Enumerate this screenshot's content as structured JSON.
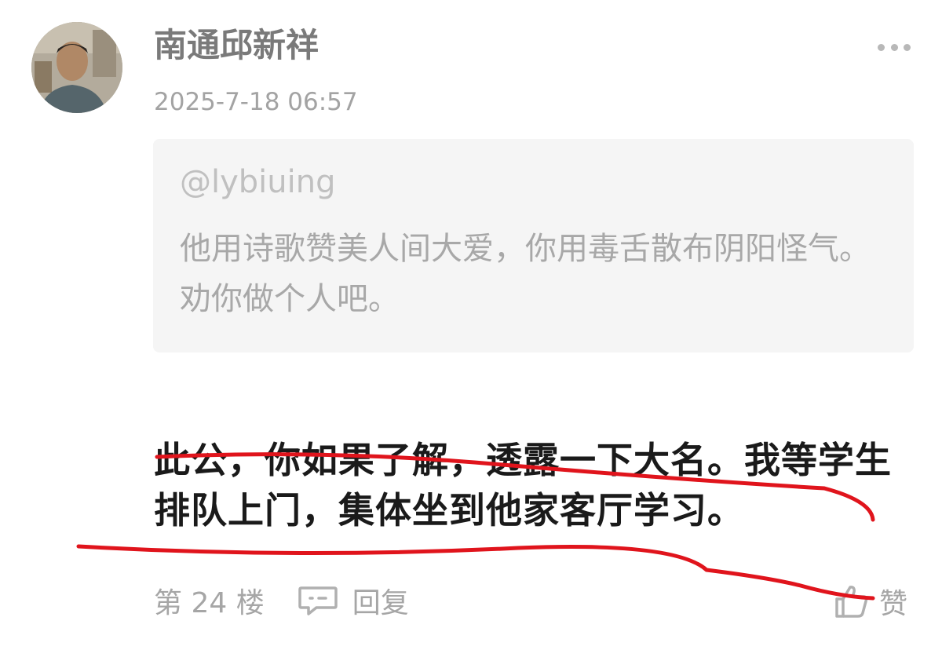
{
  "comment": {
    "author": "南通邱新祥",
    "timestamp": "2025-7-18 06:57",
    "quote": {
      "author": "@lybiuing",
      "text": "他用诗歌赞美人间大爱，你用毒舌散布阴阳怪气。劝你做个人吧。"
    },
    "text": "此公，你如果了解，透露一下大名。我等学生排队上门，集体坐到他家客厅学习。",
    "floor": "第 24 楼",
    "reply_label": "回复",
    "like_label": "赞"
  },
  "icons": [
    "more-icon",
    "reply-icon",
    "thumbs-up-icon"
  ],
  "colors": {
    "author": "#7a7a7a",
    "meta": "#a3a3a3",
    "quote_bg": "#f5f5f5",
    "body_text": "#1a1a1a",
    "annotation": "#e0141c"
  }
}
